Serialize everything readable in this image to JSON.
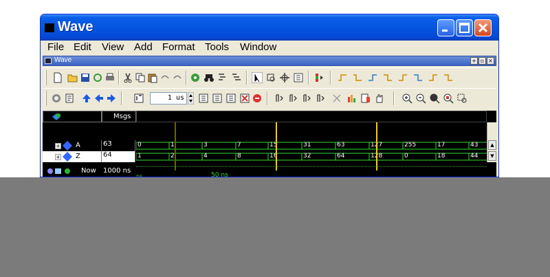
{
  "window": {
    "title": "Wave",
    "controls": {
      "minimize": "minimize-button",
      "maximize": "maximize-button",
      "close": "close-button"
    }
  },
  "menubar": {
    "items": [
      {
        "label": "File"
      },
      {
        "label": "Edit"
      },
      {
        "label": "View"
      },
      {
        "label": "Add"
      },
      {
        "label": "Format"
      },
      {
        "label": "Tools"
      },
      {
        "label": "Window"
      }
    ]
  },
  "inner_window": {
    "title": "Wave"
  },
  "toolbar": {
    "time_input": "1 us",
    "icons_row1": [
      "new-icon",
      "open-icon",
      "save-icon",
      "reload-icon",
      "print-icon",
      "cut-icon",
      "copy-icon",
      "paste-icon",
      "undo-icon",
      "redo-icon",
      "find-icon",
      "binoculars-icon",
      "collapse-icon",
      "expand-icon",
      "select-icon",
      "zoom-area-icon",
      "move-icon",
      "edit-icon",
      "break-icon",
      "wave-edge-icon"
    ],
    "icons_row2": [
      "restart-icon",
      "run-config-icon",
      "up-arrow-icon",
      "left-arrow-icon",
      "right-arrow-icon",
      "step-icon",
      "run-icon",
      "continue-icon",
      "run-all-icon",
      "break-icon",
      "stop-icon",
      "step-into-icon",
      "step-over-icon",
      "step-out-icon",
      "zoom-in-icon",
      "zoom-out-icon",
      "zoom-full-icon",
      "zoom-cursor-icon"
    ]
  },
  "wave": {
    "header_msgs": "Msgs",
    "signals": [
      {
        "name": "A",
        "value": "63",
        "selected": false,
        "waves": [
          "0",
          "1",
          "3",
          "7",
          "15",
          "31",
          "63",
          "127",
          "255",
          "17",
          "43"
        ]
      },
      {
        "name": "Z",
        "value": "64",
        "selected": true,
        "waves": [
          "1",
          "2",
          "4",
          "8",
          "16",
          "32",
          "64",
          "128",
          "0",
          "18",
          "44"
        ]
      }
    ],
    "now_label": "Now",
    "now_value": "1000 ns",
    "time_start": "ns",
    "time_mark": "50 ns"
  }
}
